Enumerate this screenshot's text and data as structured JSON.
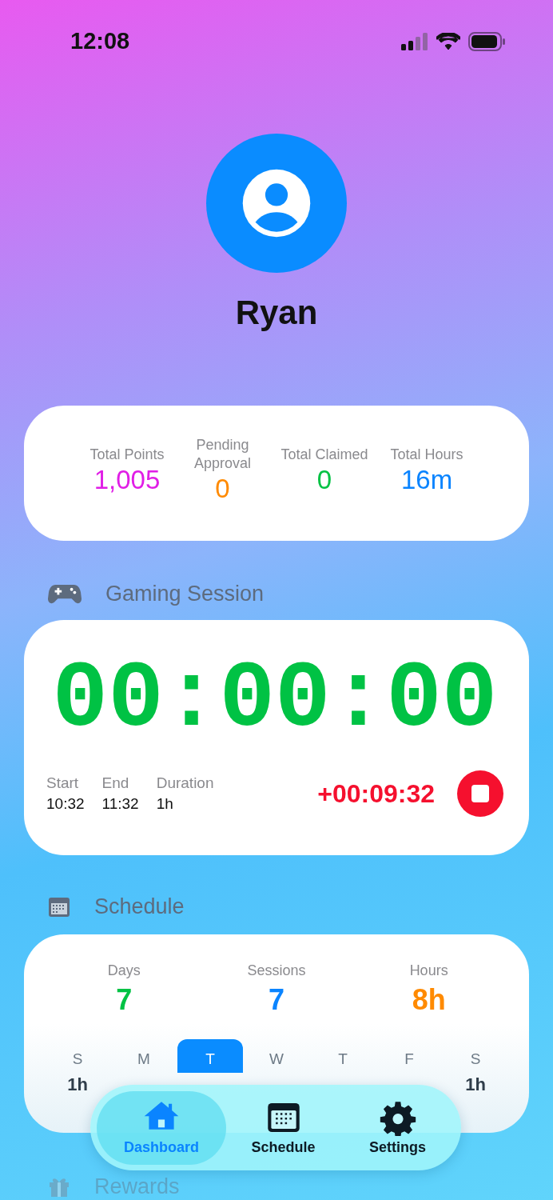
{
  "status_bar": {
    "time": "12:08"
  },
  "profile": {
    "name": "Ryan"
  },
  "stats": [
    {
      "label": "Total Points",
      "value": "1,005",
      "color": "#e01ee6"
    },
    {
      "label": "Pending Approval",
      "value": "0",
      "color": "#ff8a00"
    },
    {
      "label": "Total Claimed",
      "value": "0",
      "color": "#00c244"
    },
    {
      "label": "Total Hours",
      "value": "16m",
      "color": "#0a84ff"
    }
  ],
  "gaming_session": {
    "title": "Gaming Session",
    "timer": "00:00:00",
    "details": [
      {
        "label": "Start",
        "value": "10:32"
      },
      {
        "label": "End",
        "value": "11:32"
      },
      {
        "label": "Duration",
        "value": "1h"
      }
    ],
    "overtime": "+00:09:32"
  },
  "schedule": {
    "title": "Schedule",
    "summary": [
      {
        "label": "Days",
        "value": "7",
        "color": "#00c244"
      },
      {
        "label": "Sessions",
        "value": "7",
        "color": "#0a84ff"
      },
      {
        "label": "Hours",
        "value": "8h",
        "color": "#ff8a00"
      }
    ],
    "days": [
      {
        "letter": "S",
        "hours": "1h",
        "selected": false
      },
      {
        "letter": "M",
        "selected": false
      },
      {
        "letter": "T",
        "selected": true
      },
      {
        "letter": "W",
        "selected": false
      },
      {
        "letter": "T",
        "selected": false
      },
      {
        "letter": "F",
        "selected": false
      },
      {
        "letter": "S",
        "hours": "1h",
        "selected": false
      }
    ]
  },
  "rewards": {
    "title": "Rewards"
  },
  "tab_bar": [
    {
      "kind": "home",
      "label": "Dashboard",
      "selected": true
    },
    {
      "kind": "calendar",
      "label": "Schedule",
      "selected": false
    },
    {
      "kind": "gear",
      "label": "Settings",
      "selected": false
    }
  ]
}
